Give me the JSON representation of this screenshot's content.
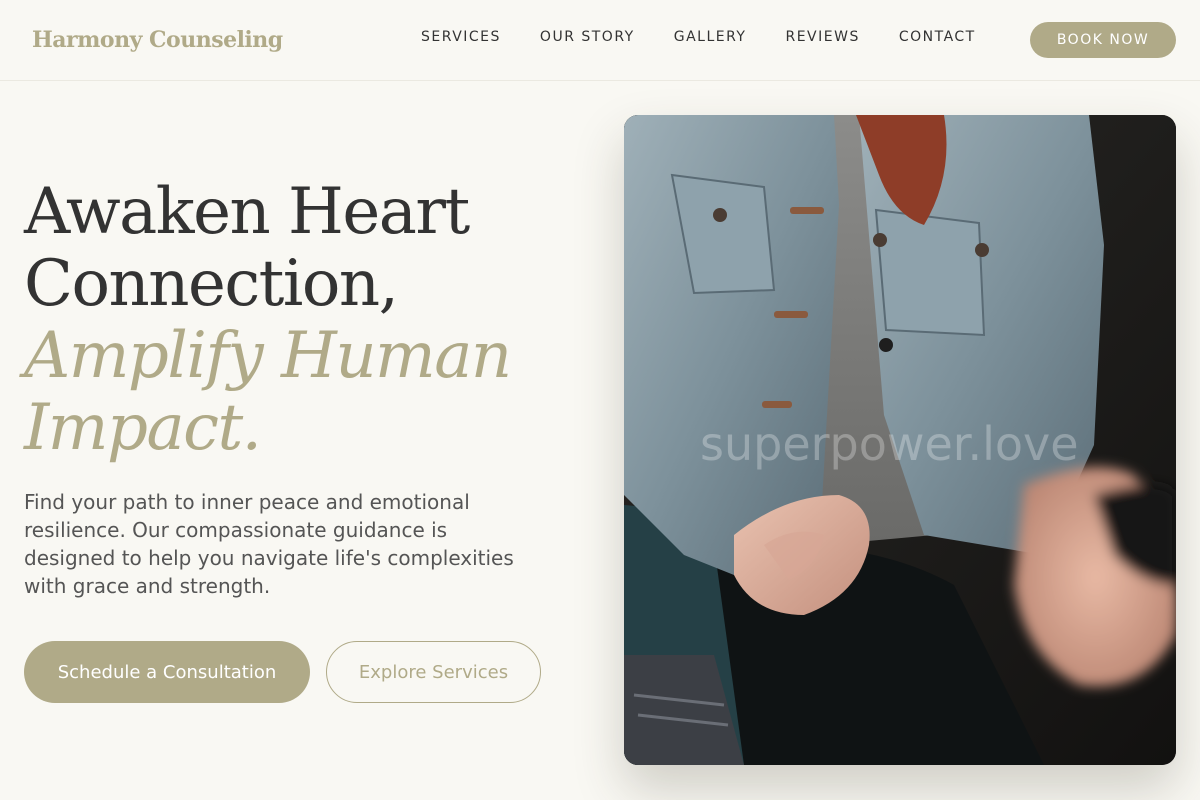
{
  "header": {
    "brand": "Harmony Counseling",
    "nav": [
      {
        "label": "SERVICES"
      },
      {
        "label": "OUR STORY"
      },
      {
        "label": "GALLERY"
      },
      {
        "label": "REVIEWS"
      },
      {
        "label": "CONTACT"
      }
    ],
    "book_label": "BOOK NOW"
  },
  "hero": {
    "headline": {
      "line1": "Awaken Heart",
      "line2": "Connection,",
      "line3": "Amplify Human",
      "line4": "Impact."
    },
    "lead": "Find your path to inner peace and emotional resilience. Our compassionate guidance is designed to help you navigate life's complexities with grace and strength.",
    "primary_cta": "Schedule a Consultation",
    "secondary_cta": "Explore Services",
    "photo": {
      "subject": "photo-counseling-session",
      "watermark": "superpower.love"
    }
  },
  "colors": {
    "background": "#f9f8f3",
    "accent": "#b0aa88",
    "text": "#333333",
    "muted_text": "#555555"
  }
}
